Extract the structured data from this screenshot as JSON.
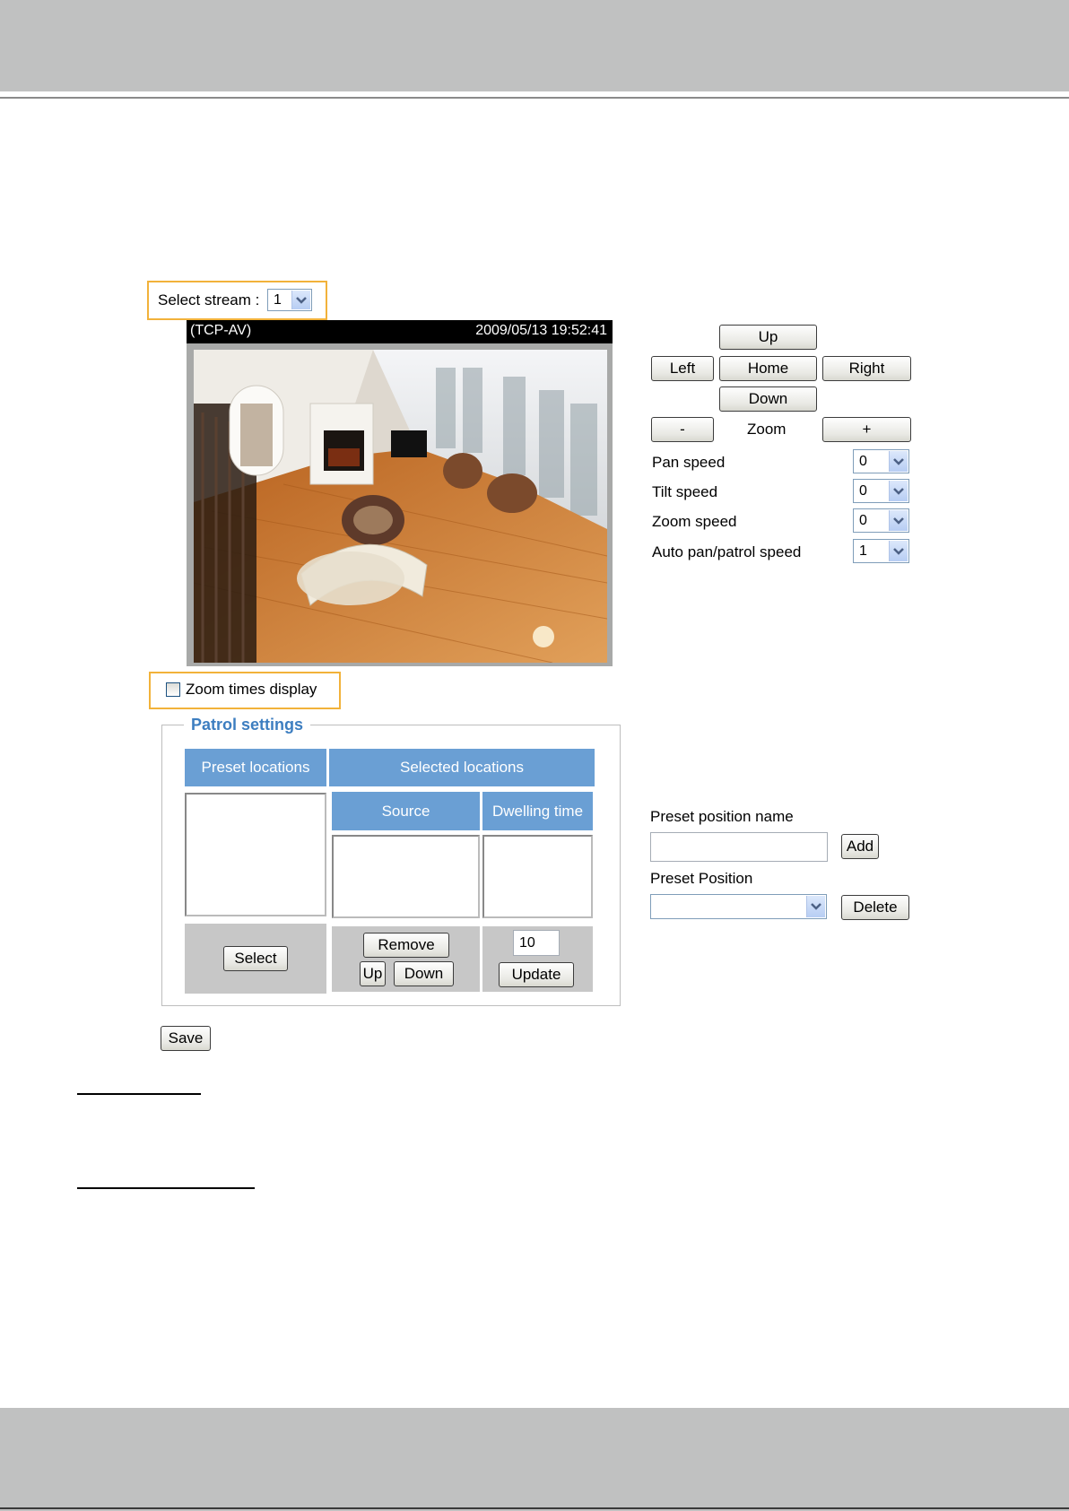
{
  "stream": {
    "label": "Select stream :",
    "value": "1"
  },
  "video": {
    "protocol": "(TCP-AV)",
    "timestamp": "2009/05/13 19:52:41"
  },
  "ptz": {
    "up": "Up",
    "left": "Left",
    "home": "Home",
    "right": "Right",
    "down": "Down",
    "zoom_out": "-",
    "zoom_label": "Zoom",
    "zoom_in": "+"
  },
  "speeds": [
    {
      "label": "Pan speed",
      "value": "0"
    },
    {
      "label": "Tilt speed",
      "value": "0"
    },
    {
      "label": "Zoom speed",
      "value": "0"
    },
    {
      "label": "Auto pan/patrol speed",
      "value": "1"
    }
  ],
  "zoom_display": {
    "label": "Zoom times display",
    "checked": false
  },
  "patrol": {
    "legend": "Patrol settings",
    "preset_locations": "Preset locations",
    "selected_locations": "Selected locations",
    "source": "Source",
    "dwelling_time": "Dwelling time",
    "select": "Select",
    "remove": "Remove",
    "up": "Up",
    "down": "Down",
    "dwell_value": "10",
    "update": "Update"
  },
  "save": "Save",
  "preset": {
    "name_label": "Preset position name",
    "name_value": "",
    "add": "Add",
    "position_label": "Preset Position",
    "position_value": "",
    "delete": "Delete"
  },
  "colors": {
    "accent_blue": "#6a9fd4",
    "highlight": "#f2b23a",
    "legend_blue": "#3d7ec0"
  }
}
